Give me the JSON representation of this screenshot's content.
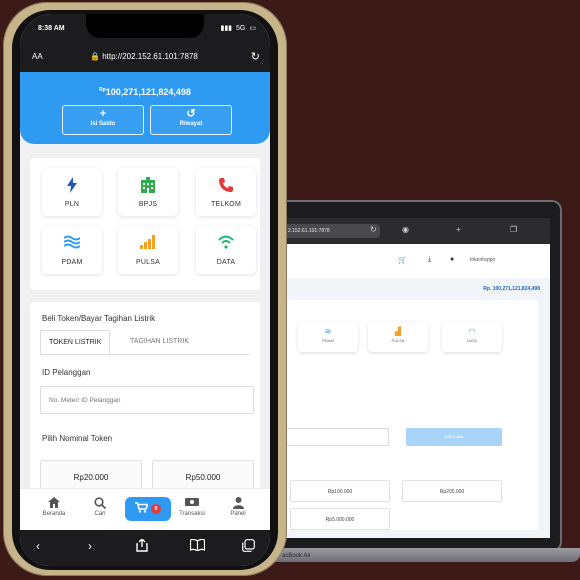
{
  "colors": {
    "background": "#3b1a17",
    "primary": "#2f9af2",
    "badge": "#e23b3b",
    "pln": "#1f56c4",
    "bpjs": "#2eae4e",
    "telkom": "#e03b3b",
    "pdam": "#2f9af2",
    "pulsa": "#f4a127",
    "data": "#22b573"
  },
  "statusbar": {
    "time": "8:38 AM",
    "network": "5G"
  },
  "browser": {
    "aa_label": "AA",
    "url": "http://202.152.61.101:7878"
  },
  "header": {
    "currency": "Rp",
    "balance": "100,271,121,824,498",
    "buttons": [
      {
        "label": "Isi Saldo",
        "icon": "plus-icon"
      },
      {
        "label": "Riwayat",
        "icon": "history-icon"
      }
    ]
  },
  "services": [
    {
      "label": "PLN",
      "icon": "lightning-icon"
    },
    {
      "label": "BPJS",
      "icon": "building-icon"
    },
    {
      "label": "TELKOM",
      "icon": "phone-icon"
    },
    {
      "label": "PDAM",
      "icon": "water-icon"
    },
    {
      "label": "PULSA",
      "icon": "signal-icon"
    },
    {
      "label": "DATA",
      "icon": "wifi-icon"
    }
  ],
  "form": {
    "title": "Beli Token/Bayar Tagihan Listrik",
    "tabs": [
      {
        "label": "TOKEN LISTRIK",
        "active": true
      },
      {
        "label": "TAGIHAN LISTRIK",
        "active": false
      }
    ],
    "id_label": "ID Pelanggan",
    "id_placeholder": "No. Meter/ ID Pelanggan",
    "nominal_label": "Pilih Nominal Token",
    "nominals": [
      "Rp20.000",
      "Rp50.000"
    ]
  },
  "bottom_nav": {
    "items": [
      {
        "label": "Beranda",
        "icon": "home-icon"
      },
      {
        "label": "Cari",
        "icon": "search-icon"
      },
      {
        "label": "Transaksi",
        "icon": "money-icon"
      },
      {
        "label": "Panel",
        "icon": "user-icon"
      }
    ],
    "cart_count": "0"
  },
  "laptop": {
    "url": "2.152.61.101:7878",
    "user": "tokenlisppo",
    "balance": "Rp. 100,271,121,824,498",
    "tiles": [
      "PDAM",
      "PULSA",
      "DATA"
    ],
    "button": "Beli Token",
    "nominals": [
      "Rp100.000",
      "Rp200.000",
      "Rp5.000.000"
    ],
    "model": "acBook Air"
  }
}
